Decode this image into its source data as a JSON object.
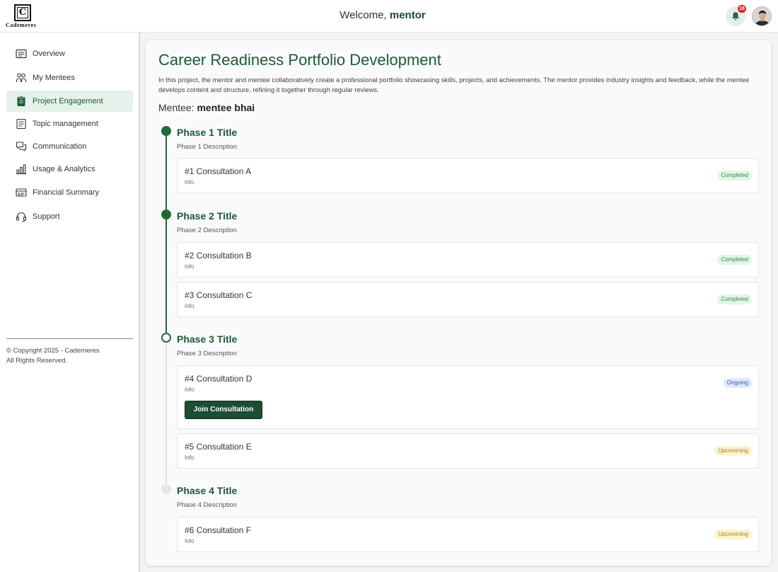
{
  "brand": {
    "logo_letter": "C",
    "name": "Cademeres"
  },
  "header": {
    "welcome_prefix": "Welcome,",
    "user_name": "mentor",
    "notification_count": "18"
  },
  "sidebar": {
    "items": [
      {
        "label": "Overview",
        "icon": "overview-icon"
      },
      {
        "label": "My Mentees",
        "icon": "mentees-icon"
      },
      {
        "label": "Project Engagement",
        "icon": "project-icon",
        "active": true
      },
      {
        "label": "Topic management",
        "icon": "topic-icon"
      },
      {
        "label": "Communication",
        "icon": "chat-icon"
      },
      {
        "label": "Usage & Analytics",
        "icon": "analytics-icon"
      },
      {
        "label": "Financial Summary",
        "icon": "finance-icon"
      },
      {
        "label": "Support",
        "icon": "headset-icon"
      }
    ],
    "copyright_line1": "© Copyright 2025 - Cademeres",
    "copyright_line2": "All Rights Reserved."
  },
  "project": {
    "title": "Career Readiness Portfolio Development",
    "description": "In this project, the mentor and mentee collaboratively create a professional portfolio showcasing skills, projects, and achievements. The mentor provides industry insights and feedback, while the mentee develops content and structure, refining it together through regular reviews.",
    "mentee_label": "Mentee:",
    "mentee_name": "mentee bhai"
  },
  "phases": [
    {
      "title": "Phase 1 Title",
      "description": "Phase 1 Description",
      "consultations": [
        {
          "name": "#1 Consultation A",
          "info": "Info",
          "status": "Completed"
        }
      ]
    },
    {
      "title": "Phase 2 Title",
      "description": "Phase 2 Description",
      "consultations": [
        {
          "name": "#2 Consultation B",
          "info": "Info",
          "status": "Completed"
        },
        {
          "name": "#3 Consultation C",
          "info": "Info",
          "status": "Completed"
        }
      ]
    },
    {
      "title": "Phase 3 Title",
      "description": "Phase 3 Description",
      "consultations": [
        {
          "name": "#4 Consultation D",
          "info": "Info",
          "status": "Ongoing",
          "action": "Join Consultation"
        },
        {
          "name": "#5 Consultation E",
          "info": "Info",
          "status": "Upcomming"
        }
      ]
    },
    {
      "title": "Phase 4 Title",
      "description": "Phase 4 Description",
      "consultations": [
        {
          "name": "#6 Consultation F",
          "info": "Info",
          "status": "Upcomming"
        }
      ]
    }
  ],
  "colors": {
    "brand_green": "#1d5a34",
    "active_nav_bg": "#e5f1ea",
    "join_button": "#1d4d35",
    "completed_badge": "#e3f6e8",
    "ongoing_badge": "#e1e8fb",
    "upcoming_badge": "#fbf4cf",
    "notification_badge": "#d92a2a"
  }
}
